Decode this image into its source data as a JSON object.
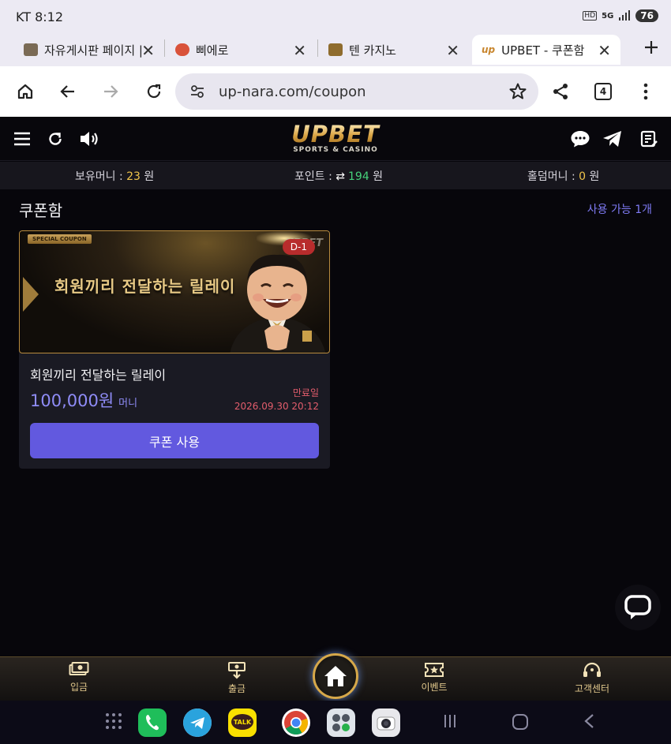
{
  "status_bar": {
    "carrier": "KT 8:12",
    "hd": "HD",
    "network": "5G",
    "battery": "76"
  },
  "browser": {
    "tabs": [
      {
        "title": "자유게시판 페이지 |",
        "active": false
      },
      {
        "title": "삐에로",
        "active": false
      },
      {
        "title": "텐 카지노",
        "active": false
      },
      {
        "title": "UPBET - 쿠폰함",
        "active": true
      }
    ],
    "new_tab_icon": "plus-icon",
    "url": "up-nara.com/coupon",
    "tab_count": "4"
  },
  "site": {
    "logo_main": "UPBET",
    "logo_sub": "SPORTS & CASINO",
    "balances": {
      "holding_label": "보유머니 : ",
      "holding_value": "23",
      "holding_unit": " 원",
      "points_label": "포인트 : ",
      "points_value": "194",
      "points_unit": " 원",
      "holdem_label": "홀덤머니 : ",
      "holdem_value": "0",
      "holdem_unit": " 원"
    }
  },
  "coupon_page": {
    "title": "쿠폰함",
    "available": "사용 가능 1개",
    "coupons": [
      {
        "banner_tag": "SPECIAL COUPON",
        "banner_text": "회원끼리 전달하는 릴레이",
        "banner_watermark": "UPBET",
        "dday": "D-1",
        "title": "회원끼리 전달하는 릴레이",
        "amount": "100,000원",
        "unit": "머니",
        "expiry_label": "만료일",
        "expiry_date": "2026.09.30 20:12",
        "button": "쿠폰 사용"
      }
    ]
  },
  "bottom_nav": {
    "deposit": "입금",
    "withdraw": "출금",
    "event": "이벤트",
    "support": "고객센터"
  },
  "colors": {
    "accent": "#6259df",
    "gold": "#d6a84a",
    "expiry": "#e35d6c"
  }
}
